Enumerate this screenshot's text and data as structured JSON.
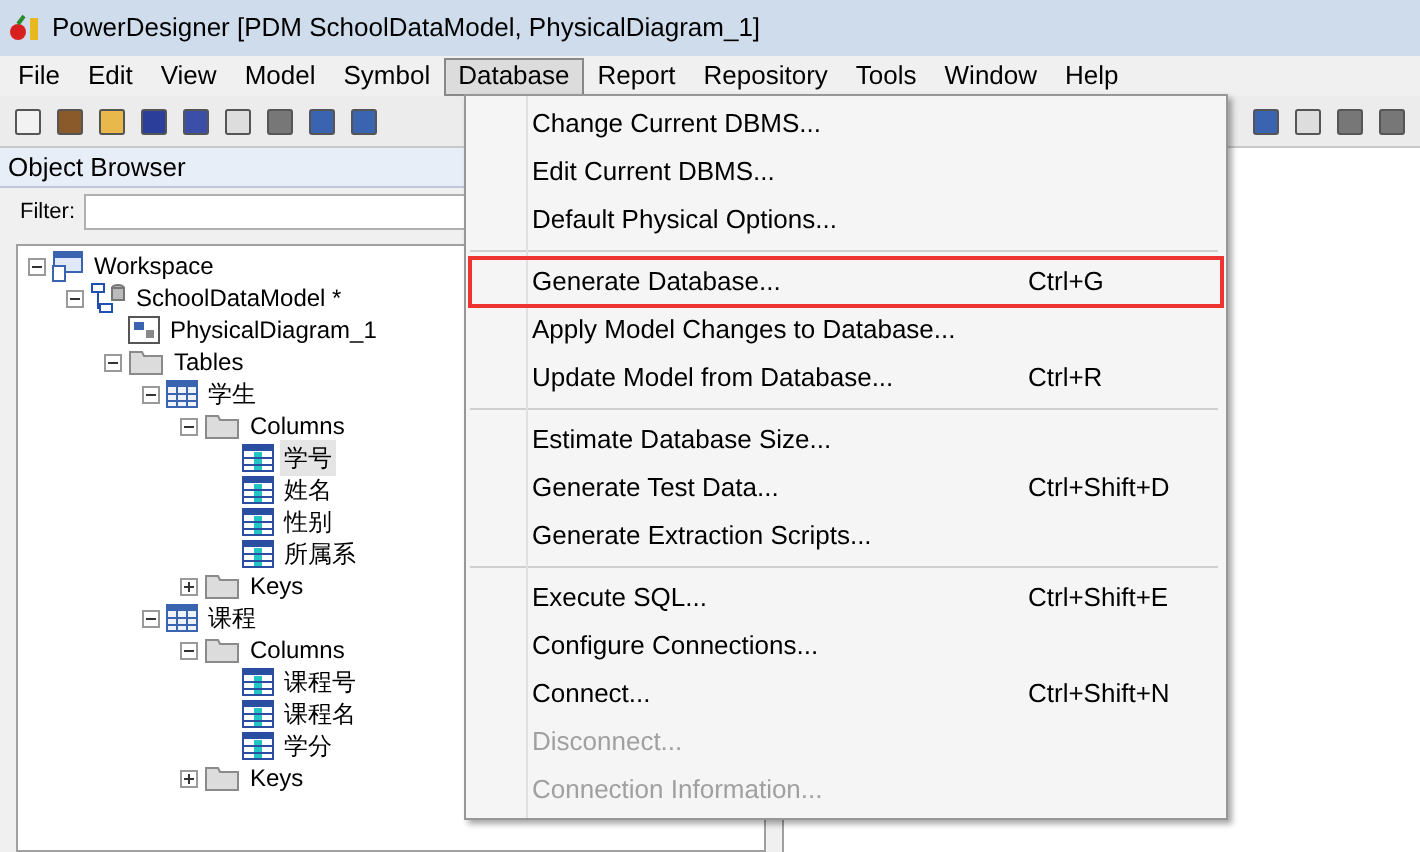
{
  "window": {
    "title": "PowerDesigner [PDM SchoolDataModel, PhysicalDiagram_1]"
  },
  "menu_bar": [
    {
      "label": "File",
      "selected": false
    },
    {
      "label": "Edit",
      "selected": false
    },
    {
      "label": "View",
      "selected": false
    },
    {
      "label": "Model",
      "selected": false
    },
    {
      "label": "Symbol",
      "selected": false
    },
    {
      "label": "Database",
      "selected": true
    },
    {
      "label": "Report",
      "selected": false
    },
    {
      "label": "Repository",
      "selected": false
    },
    {
      "label": "Tools",
      "selected": false
    },
    {
      "label": "Window",
      "selected": false
    },
    {
      "label": "Help",
      "selected": false
    }
  ],
  "object_browser": {
    "title": "Object Browser",
    "filter_label": "Filter:",
    "tree": [
      {
        "label": "Workspace",
        "kind": "workspace",
        "expanded": true,
        "selected": false,
        "children": [
          {
            "label": "SchoolDataModel *",
            "kind": "model",
            "expanded": true,
            "selected": false,
            "children": [
              {
                "label": "PhysicalDiagram_1",
                "kind": "diagram",
                "selected": false
              },
              {
                "label": "Tables",
                "kind": "folder",
                "expanded": true,
                "selected": false,
                "children": [
                  {
                    "label": "学生",
                    "kind": "table",
                    "expanded": true,
                    "selected": false,
                    "children": [
                      {
                        "label": "Columns",
                        "kind": "folder",
                        "expanded": true,
                        "selected": false,
                        "children": [
                          {
                            "label": "学号",
                            "kind": "column",
                            "selected": true
                          },
                          {
                            "label": "姓名",
                            "kind": "column",
                            "selected": false
                          },
                          {
                            "label": "性别",
                            "kind": "column",
                            "selected": false
                          },
                          {
                            "label": "所属系",
                            "kind": "column",
                            "selected": false
                          }
                        ]
                      },
                      {
                        "label": "Keys",
                        "kind": "folder",
                        "expanded": false,
                        "selected": false
                      }
                    ]
                  },
                  {
                    "label": "课程",
                    "kind": "table",
                    "expanded": true,
                    "selected": false,
                    "children": [
                      {
                        "label": "Columns",
                        "kind": "folder",
                        "expanded": true,
                        "selected": false,
                        "children": [
                          {
                            "label": "课程号",
                            "kind": "column",
                            "selected": false
                          },
                          {
                            "label": "课程名",
                            "kind": "column",
                            "selected": false
                          },
                          {
                            "label": "学分",
                            "kind": "column",
                            "selected": false
                          }
                        ]
                      },
                      {
                        "label": "Keys",
                        "kind": "folder",
                        "expanded": false,
                        "selected": false
                      }
                    ]
                  }
                ]
              }
            ]
          }
        ]
      }
    ]
  },
  "database_menu": [
    {
      "kind": "item",
      "label": "Change Current DBMS...",
      "disabled": false,
      "highlighted": false
    },
    {
      "kind": "item",
      "label": "Edit Current DBMS...",
      "disabled": false,
      "highlighted": false
    },
    {
      "kind": "item",
      "label": "Default Physical Options...",
      "disabled": false,
      "highlighted": false
    },
    {
      "kind": "separator"
    },
    {
      "kind": "item",
      "label": "Generate Database...",
      "shortcut": "Ctrl+G",
      "disabled": false,
      "highlighted": true
    },
    {
      "kind": "item",
      "label": "Apply Model Changes to Database...",
      "disabled": false,
      "highlighted": false
    },
    {
      "kind": "item",
      "label": "Update Model from Database...",
      "shortcut": "Ctrl+R",
      "disabled": false,
      "highlighted": false
    },
    {
      "kind": "separator"
    },
    {
      "kind": "item",
      "label": "Estimate Database Size...",
      "disabled": false,
      "highlighted": false
    },
    {
      "kind": "item",
      "label": "Generate Test Data...",
      "shortcut": "Ctrl+Shift+D",
      "disabled": false,
      "highlighted": false
    },
    {
      "kind": "item",
      "label": "Generate Extraction Scripts...",
      "disabled": false,
      "highlighted": false
    },
    {
      "kind": "separator"
    },
    {
      "kind": "item",
      "label": "Execute SQL...",
      "shortcut": "Ctrl+Shift+E",
      "disabled": false,
      "highlighted": false
    },
    {
      "kind": "item",
      "label": "Configure Connections...",
      "disabled": false,
      "highlighted": false
    },
    {
      "kind": "item",
      "label": "Connect...",
      "shortcut": "Ctrl+Shift+N",
      "disabled": false,
      "highlighted": false
    },
    {
      "kind": "item",
      "label": "Disconnect...",
      "disabled": true,
      "highlighted": false
    },
    {
      "kind": "item",
      "label": "Connection Information...",
      "disabled": true,
      "highlighted": false
    }
  ]
}
